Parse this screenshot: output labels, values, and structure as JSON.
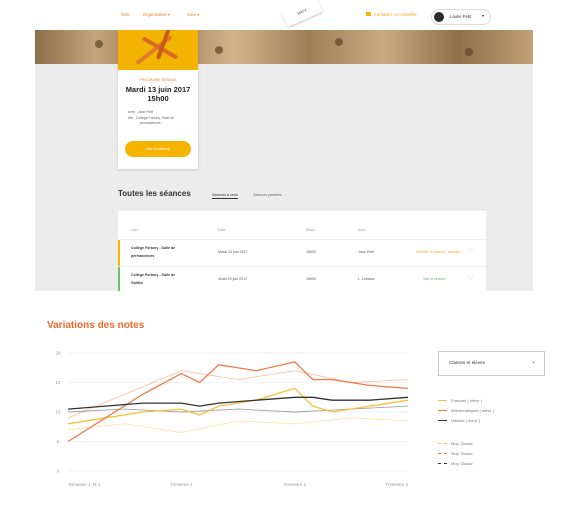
{
  "nav": {
    "items": [
      "Note",
      "Organisation ▾",
      "Suivi ▾"
    ],
    "contact": "Contacter un conseiller",
    "user": "Laurie Petit",
    "logo": "MAF4"
  },
  "card": {
    "kicker": "PROCHAINE SÉANCE",
    "date": "Mardi 13 juin 2017",
    "time": "15h00",
    "meta": [
      {
        "label": "avec",
        "value": "Jane Petit"
      },
      {
        "label": "lieu",
        "value": "Collège Fortuny, Salle de"
      },
      {
        "label": "",
        "value": "permanences"
      }
    ],
    "button": "Voir la séance"
  },
  "sessions": {
    "title": "Toutes les séances",
    "tabs": [
      "Séances à venir",
      "Séances passées"
    ],
    "columns": [
      "Lieu",
      "Date",
      "Heure",
      "Avec"
    ],
    "rows": [
      {
        "place": "Collège Fortuny - Salle de",
        "place2": "permanences",
        "date": "Mardi 13 juin 2017",
        "time": "15h00",
        "with": "Jane Petit",
        "action": "Modifier la séance / Annuler",
        "action_color": "#f5a623",
        "bar_color": "#f5b400"
      },
      {
        "place": "Collège Fortuny - Salle de",
        "place2": "Galilée",
        "date": "Jeudi 15 juin 2017",
        "time": "15h00",
        "with": "L. Leblanc",
        "action": "Voir la séance",
        "action_color": "#5cb85c",
        "bar_color": "#6cc070"
      }
    ]
  },
  "chart": {
    "title": "Variations des notes",
    "select_value": "Classes et élèves",
    "select_caret": "⌄",
    "legend": [
      {
        "label": "Français ( élève )",
        "color": "#f7c03a",
        "style": "solid"
      },
      {
        "label": "Mathématiques ( élève )",
        "color": "#f07a4a",
        "style": "solid"
      },
      {
        "label": "Histoire ( élève )",
        "color": "#333333",
        "style": "solid"
      },
      {
        "label": "Moy. Classe",
        "color": "#f7c03a",
        "style": "dashed"
      },
      {
        "label": "Moy. Classe",
        "color": "#f07a4a",
        "style": "dashed"
      },
      {
        "label": "Moy. Classe",
        "color": "#333333",
        "style": "dashed"
      }
    ]
  },
  "chart_data": {
    "type": "line",
    "title": "Variations des notes",
    "x": [
      "Trimestre 1, N-1",
      "Trimestre 1",
      "Trimestre 2",
      "Trimestre 3"
    ],
    "x_positions": [
      0,
      1,
      2,
      3
    ],
    "ylim": [
      0,
      20
    ],
    "yticks": [
      0,
      5,
      10,
      15,
      20
    ],
    "grid": true,
    "legend_position": "right",
    "series": [
      {
        "name": "Français ( élève )",
        "color": "#f7c03a",
        "style": "solid",
        "x": [
          0,
          0.33,
          0.66,
          1.0,
          1.16,
          1.33,
          1.66,
          2.0,
          2.16,
          2.33,
          2.66,
          3.0
        ],
        "values": [
          8,
          9,
          10,
          10.5,
          9.5,
          11,
          12,
          14,
          11,
          10,
          11,
          12
        ]
      },
      {
        "name": "Mathématiques ( élève )",
        "color": "#f07a4a",
        "style": "solid",
        "x": [
          0,
          0.33,
          0.66,
          1.0,
          1.16,
          1.33,
          1.66,
          2.0,
          2.16,
          2.33,
          2.66,
          3.0
        ],
        "values": [
          5,
          9,
          13,
          16.5,
          15,
          18,
          17,
          18.5,
          15.5,
          15.5,
          14.5,
          14
        ]
      },
      {
        "name": "Histoire ( élève )",
        "color": "#333333",
        "style": "solid",
        "x": [
          0,
          0.33,
          0.66,
          1.0,
          1.16,
          1.33,
          1.66,
          2.0,
          2.16,
          2.33,
          2.66,
          3.0
        ],
        "values": [
          10.5,
          11,
          11.5,
          11.5,
          11,
          11.5,
          12,
          12.5,
          12.5,
          12,
          12,
          12.5
        ]
      },
      {
        "name": "Moy. Classe",
        "color": "#f7c03a",
        "style": "dashed",
        "x": [
          0,
          0.5,
          1.0,
          1.5,
          2.0,
          2.5,
          3.0
        ],
        "values": [
          7,
          8,
          6.5,
          8.5,
          8,
          9,
          8.5
        ]
      },
      {
        "name": "Moy. Classe",
        "color": "#f07a4a",
        "style": "dashed",
        "x": [
          0,
          0.5,
          1.0,
          1.5,
          2.0,
          2.5,
          3.0
        ],
        "values": [
          9,
          13,
          17,
          15.5,
          17,
          15,
          15.5
        ]
      },
      {
        "name": "Moy. Classe",
        "color": "#333333",
        "style": "dashed",
        "x": [
          0,
          0.5,
          1.0,
          1.5,
          2.0,
          2.5,
          3.0
        ],
        "values": [
          10,
          10.5,
          10,
          10.5,
          10,
          10.5,
          11
        ]
      }
    ]
  }
}
